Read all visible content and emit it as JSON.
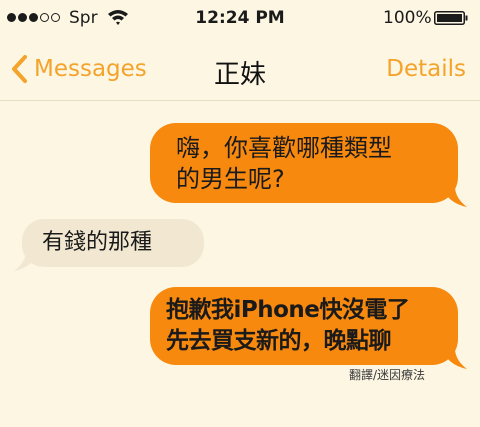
{
  "status_bar": {
    "carrier": "Spr",
    "time": "12:24 PM",
    "battery_percent": "100%",
    "signal_bars_filled": 3,
    "signal_bars_total": 5,
    "icons": [
      "wifi-icon",
      "battery-icon"
    ]
  },
  "nav": {
    "back_label": "Messages",
    "title": "正妹",
    "details_label": "Details",
    "accent_color": "#f4a32b"
  },
  "messages": [
    {
      "direction": "sent",
      "text": "嗨，你喜歡哪種類型\n的男生呢?"
    },
    {
      "direction": "received",
      "text": "有錢的那種"
    },
    {
      "direction": "sent",
      "text": "抱歉我iPhone快沒電了\n先去買支新的，晚點聊"
    }
  ],
  "credit": "翻譯/迷因療法",
  "colors": {
    "sent_bubble": "#f7890f",
    "received_bubble": "#f2e8d2",
    "background": "#fcf6e3"
  }
}
